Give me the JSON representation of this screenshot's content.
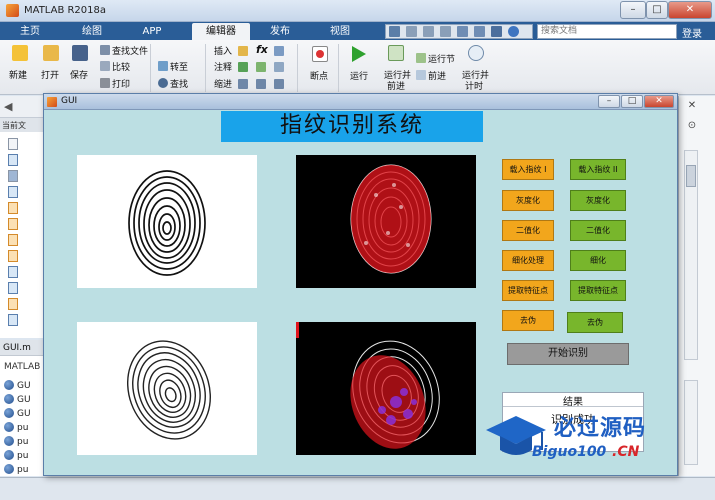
{
  "app": {
    "title": "MATLAB R2018a"
  },
  "window_controls": {
    "minimize": "–",
    "maximize": "□",
    "close": "✕"
  },
  "tabs": [
    {
      "label": "主页"
    },
    {
      "label": "绘图"
    },
    {
      "label": "APP"
    },
    {
      "label": "编辑器"
    },
    {
      "label": "发布"
    },
    {
      "label": "视图"
    }
  ],
  "search": {
    "placeholder": "搜索文档"
  },
  "login_label": "登录",
  "ribbon": {
    "new": "新建",
    "open": "打开",
    "save": "保存",
    "find_files": "查找文件",
    "compare": "比较",
    "print": "打印",
    "goto": "转至",
    "find": "查找",
    "insert": "插入",
    "comment": "注释",
    "indent": "缩进",
    "fx": "fx",
    "breakpoints": "断点",
    "run": "运行",
    "run_advance": [
      "运行并",
      "前进"
    ],
    "run_section": "运行节",
    "advance": "前进",
    "run_time": [
      "运行并",
      "计时"
    ]
  },
  "left_pane": {
    "address_arrow": "◀",
    "current_folder": "当前文",
    "gui_file": "GUI.m",
    "workspace_header": "MATLAB",
    "workspace_items": [
      "GU",
      "GU",
      "GU",
      "pu",
      "pu",
      "pu",
      "pu"
    ]
  },
  "gui": {
    "window_title": "GUI",
    "title_banner": "指纹识别系统",
    "buttons": {
      "load1": "载入指纹 I",
      "load2": "载入指纹 II",
      "gray1": "灰度化",
      "gray2": "灰度化",
      "binary1": "二值化",
      "binary2": "二值化",
      "thin1": "细化处理",
      "thin2": "细化",
      "feature1": "提取特征点",
      "feature2": "提取特征点",
      "remove1": "去伪",
      "remove2": "去伪",
      "start": "开始识别"
    },
    "result": {
      "title": "结果",
      "value": "识别成功"
    }
  },
  "watermark": {
    "text_cn": "必过源码",
    "text_en": "Biguo100",
    "text_suffix": ".CN"
  },
  "colors": {
    "orange_btn": "#f2a61c",
    "green_btn": "#78b62c",
    "banner": "#19a3ea",
    "gui_bg": "#bcdfe3"
  }
}
